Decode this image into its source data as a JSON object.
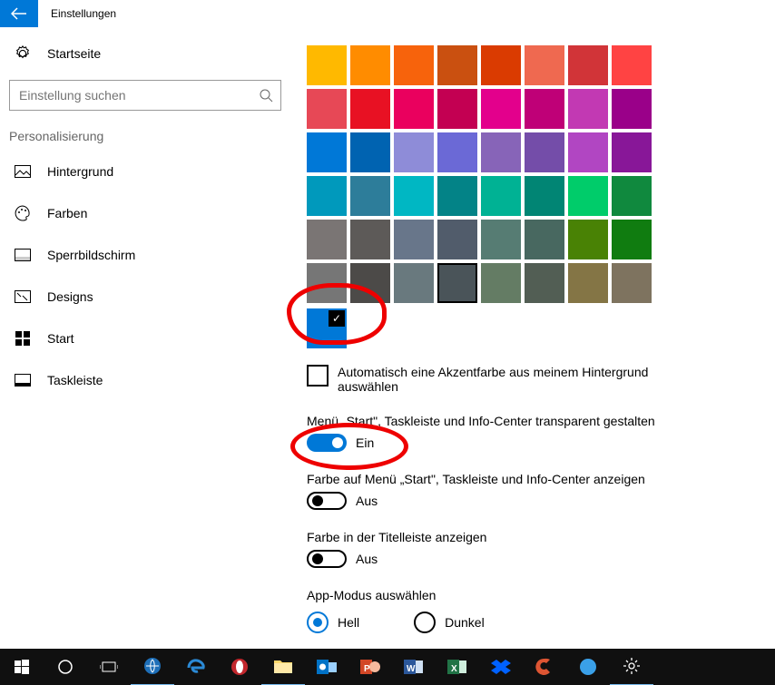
{
  "titlebar": {
    "label": "Einstellungen"
  },
  "sidebar": {
    "home": "Startseite",
    "search_placeholder": "Einstellung suchen",
    "category_header": "Personalisierung",
    "items": [
      {
        "label": "Hintergrund"
      },
      {
        "label": "Farben"
      },
      {
        "label": "Sperrbildschirm"
      },
      {
        "label": "Designs"
      },
      {
        "label": "Start"
      },
      {
        "label": "Taskleiste"
      }
    ]
  },
  "colors": {
    "swatches": [
      "#ffb900",
      "#ff8c00",
      "#f7630c",
      "#ca5010",
      "#da3b01",
      "#ef6950",
      "#d13438",
      "#ff4343",
      "#e74856",
      "#e81123",
      "#ea005e",
      "#c30052",
      "#e3008c",
      "#bf0077",
      "#c239b3",
      "#9a0089",
      "#0078d7",
      "#0063b1",
      "#8e8cd8",
      "#6b69d6",
      "#8764b8",
      "#744da9",
      "#b146c2",
      "#881798",
      "#0099bc",
      "#2d7d9a",
      "#00b7c3",
      "#038387",
      "#00b294",
      "#018574",
      "#00cc6a",
      "#10893e",
      "#7a7574",
      "#5d5a58",
      "#68768a",
      "#515c6b",
      "#567c73",
      "#486860",
      "#498205",
      "#107c10",
      "#767676",
      "#4c4a48",
      "#69797e",
      "#4a5459",
      "#647c64",
      "#525e54",
      "#847545",
      "#7e735f"
    ],
    "selected_index": 43,
    "accent": "#0078d7"
  },
  "options": {
    "auto_accent_label": "Automatisch eine Akzentfarbe aus meinem Hintergrund auswählen",
    "transparency_label": "Menü „Start\", Taskleiste und Info-Center transparent gestalten",
    "transparency_state": "Ein",
    "show_color_label": "Farbe auf Menü „Start\", Taskleiste und Info-Center anzeigen",
    "show_color_state": "Aus",
    "titlebar_color_label": "Farbe in der Titelleiste anzeigen",
    "titlebar_color_state": "Aus",
    "app_mode_label": "App-Modus auswählen",
    "app_mode_light": "Hell",
    "app_mode_dark": "Dunkel"
  }
}
